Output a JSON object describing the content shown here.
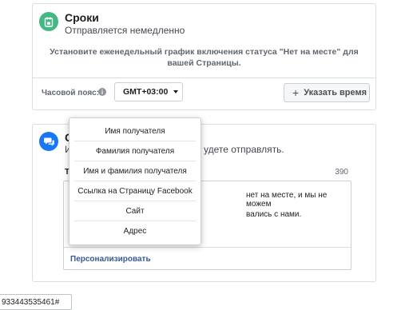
{
  "schedule_card": {
    "title": "Сроки",
    "subtitle": "Отправляется немедленно",
    "info": "Установите еженедельный график включения статуса \"Нет на месте\" для вашей Страницы.",
    "timezone_label": "Часовой пояс:",
    "timezone_info_icon": "i",
    "timezone_value": "GMT+03:00",
    "add_time_label": "Указать время",
    "add_time_icon": "+"
  },
  "message_card": {
    "title": "С",
    "subtitle_left": "И",
    "subtitle_right": "удете отправлять.",
    "label": "Т",
    "char_count": "390",
    "message_line1": "нет на месте, и мы не можем",
    "message_line2": "вались с нами.",
    "personalize_label": "Персонализировать"
  },
  "personalize_menu": {
    "items": [
      "Имя получателя",
      "Фамилия получателя",
      "Имя и фамилия получателя",
      "Ссылка на Страницу Facebook",
      "Сайт",
      "Адрес"
    ]
  },
  "bottom_field": {
    "value": "933443535461#"
  },
  "colors": {
    "schedule_icon_bg": "#42b883",
    "message_icon_bg": "#1877f2",
    "link": "#365899"
  },
  "icons": {
    "schedule": "calendar-lock-icon",
    "message": "chat-bubbles-icon",
    "info": "info-icon",
    "caret": "caret-down-icon",
    "plus": "plus-icon"
  }
}
